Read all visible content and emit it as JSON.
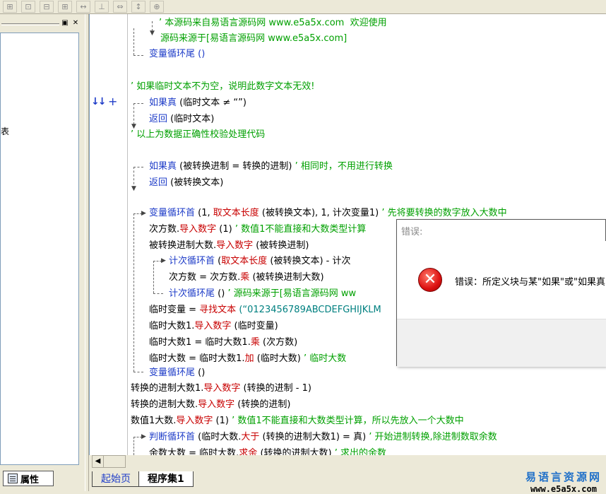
{
  "toolbar": {
    "buttons": [
      "⊞",
      "⊡",
      "⊟",
      "⊞",
      "↔",
      "⊥",
      "⇔",
      "↕",
      "⊕"
    ]
  },
  "left_panel": {
    "tree_text": "表",
    "tab_label": "属性"
  },
  "code_lines": [
    {
      "segments": [
        {
          "t": "’ 本源码来自易语言源码网 www.e5a5x.com  欢迎使用",
          "c": "green"
        }
      ]
    },
    {
      "segments": [
        {
          "t": "源码来源于[易语言源码网 www.e5a5x.com]",
          "c": "green"
        }
      ]
    },
    {
      "segments": [
        {
          "t": "变量循环尾 ()",
          "c": "blue"
        }
      ]
    },
    {
      "segments": [
        {
          "t": "’ 如果临时文本不为空，说明此数字文本无效!",
          "c": "green"
        }
      ]
    },
    {
      "segments": [
        {
          "t": "如果真",
          "c": "blue"
        },
        {
          "t": " (临时文本 ≠ “”)",
          "c": "black"
        }
      ]
    },
    {
      "segments": [
        {
          "t": "返回",
          "c": "blue"
        },
        {
          "t": " (临时文本)",
          "c": "black"
        }
      ]
    },
    {
      "segments": [
        {
          "t": "’ 以上为数据正确性校验处理代码",
          "c": "green"
        }
      ]
    },
    {
      "segments": [
        {
          "t": "如果真",
          "c": "blue"
        },
        {
          "t": " (被转换进制 = 转换的进制) ",
          "c": "black"
        },
        {
          "t": "’ 相同时，不用进行转换",
          "c": "green"
        }
      ]
    },
    {
      "segments": [
        {
          "t": "返回",
          "c": "blue"
        },
        {
          "t": " (被转换文本)",
          "c": "black"
        }
      ]
    },
    {
      "segments": [
        {
          "t": "变量循环首",
          "c": "blue"
        },
        {
          "t": " (1, ",
          "c": "black"
        },
        {
          "t": "取文本长度",
          "c": "red"
        },
        {
          "t": " (被转换文本), 1, 计次变量1) ",
          "c": "black"
        },
        {
          "t": "’ 先将要转换的数字放入大数中",
          "c": "green"
        }
      ]
    },
    {
      "segments": [
        {
          "t": "次方数.",
          "c": "black"
        },
        {
          "t": "导入数字",
          "c": "red"
        },
        {
          "t": " (1) ",
          "c": "black"
        },
        {
          "t": "’ 数值1不能直接和大数类型计算",
          "c": "green"
        }
      ]
    },
    {
      "segments": [
        {
          "t": "被转换进制大数.",
          "c": "black"
        },
        {
          "t": "导入数字",
          "c": "red"
        },
        {
          "t": " (被转换进制)",
          "c": "black"
        }
      ]
    },
    {
      "segments": [
        {
          "t": "计次循环首",
          "c": "blue"
        },
        {
          "t": " (",
          "c": "black"
        },
        {
          "t": "取文本长度",
          "c": "red"
        },
        {
          "t": " (被转换文本) - 计次",
          "c": "black"
        }
      ]
    },
    {
      "segments": [
        {
          "t": "次方数 = 次方数.",
          "c": "black"
        },
        {
          "t": "乘",
          "c": "red"
        },
        {
          "t": " (被转换进制大数)",
          "c": "black"
        }
      ]
    },
    {
      "segments": [
        {
          "t": "计次循环尾",
          "c": "blue"
        },
        {
          "t": " () ",
          "c": "black"
        },
        {
          "t": "’ 源码来源于[易语言源码网 ww",
          "c": "green"
        }
      ]
    },
    {
      "segments": [
        {
          "t": "临时变量 = ",
          "c": "black"
        },
        {
          "t": "寻找文本",
          "c": "red"
        },
        {
          "t": " (“0123456789ABCDEFGHIJKLM",
          "c": "teal"
        }
      ]
    },
    {
      "segments": [
        {
          "t": "临时大数1.",
          "c": "black"
        },
        {
          "t": "导入数字",
          "c": "red"
        },
        {
          "t": " (临时变量)",
          "c": "black"
        }
      ]
    },
    {
      "segments": [
        {
          "t": "临时大数1 = 临时大数1.",
          "c": "black"
        },
        {
          "t": "乘",
          "c": "red"
        },
        {
          "t": " (次方数)",
          "c": "black"
        }
      ]
    },
    {
      "segments": [
        {
          "t": "临时大数 = 临时大数1.",
          "c": "black"
        },
        {
          "t": "加",
          "c": "red"
        },
        {
          "t": " (临时大数) ",
          "c": "black"
        },
        {
          "t": "’ 临时大数",
          "c": "green"
        }
      ]
    },
    {
      "segments": [
        {
          "t": "变量循环尾",
          "c": "blue"
        },
        {
          "t": " ()",
          "c": "black"
        }
      ]
    },
    {
      "segments": [
        {
          "t": "转换的进制大数1.",
          "c": "black"
        },
        {
          "t": "导入数字",
          "c": "red"
        },
        {
          "t": " (转换的进制 - 1)",
          "c": "black"
        }
      ]
    },
    {
      "segments": [
        {
          "t": "转换的进制大数.",
          "c": "black"
        },
        {
          "t": "导入数字",
          "c": "red"
        },
        {
          "t": " (转换的进制)",
          "c": "black"
        }
      ]
    },
    {
      "segments": [
        {
          "t": "数值1大数.",
          "c": "black"
        },
        {
          "t": "导入数字",
          "c": "red"
        },
        {
          "t": " (1) ",
          "c": "black"
        },
        {
          "t": "’ 数值1不能直接和大数类型计算，所以先放入一个大数中",
          "c": "green"
        }
      ]
    },
    {
      "segments": [
        {
          "t": "判断循环首",
          "c": "blue"
        },
        {
          "t": " (临时大数.",
          "c": "black"
        },
        {
          "t": "大于",
          "c": "red"
        },
        {
          "t": " (转换的进制大数1) = 真) ",
          "c": "black"
        },
        {
          "t": "’ 开始进制转换,除进制数取余数",
          "c": "green"
        }
      ]
    },
    {
      "segments": [
        {
          "t": "余数大数 = 临时大数.",
          "c": "black"
        },
        {
          "t": "求余",
          "c": "red"
        },
        {
          "t": " (转换的进制大数) ",
          "c": "black"
        },
        {
          "t": "’ 求出的余数",
          "c": "green"
        }
      ]
    }
  ],
  "scrollbar": {
    "left_arrow": "◀"
  },
  "tabs": {
    "home": "起始页",
    "program": "程序集1"
  },
  "watermark": {
    "cn": "易语言资源网",
    "url": "www.e5a5x.com"
  },
  "dialog": {
    "title": "错误:",
    "message": "错误：所定义块与某\"如果\"或\"如果真",
    "icon": "error-icon",
    "accent": "#d11111"
  },
  "colors": {
    "keyword": "#1e3cc8",
    "function": "#c80000",
    "comment": "#00a000",
    "string": "#008080"
  }
}
